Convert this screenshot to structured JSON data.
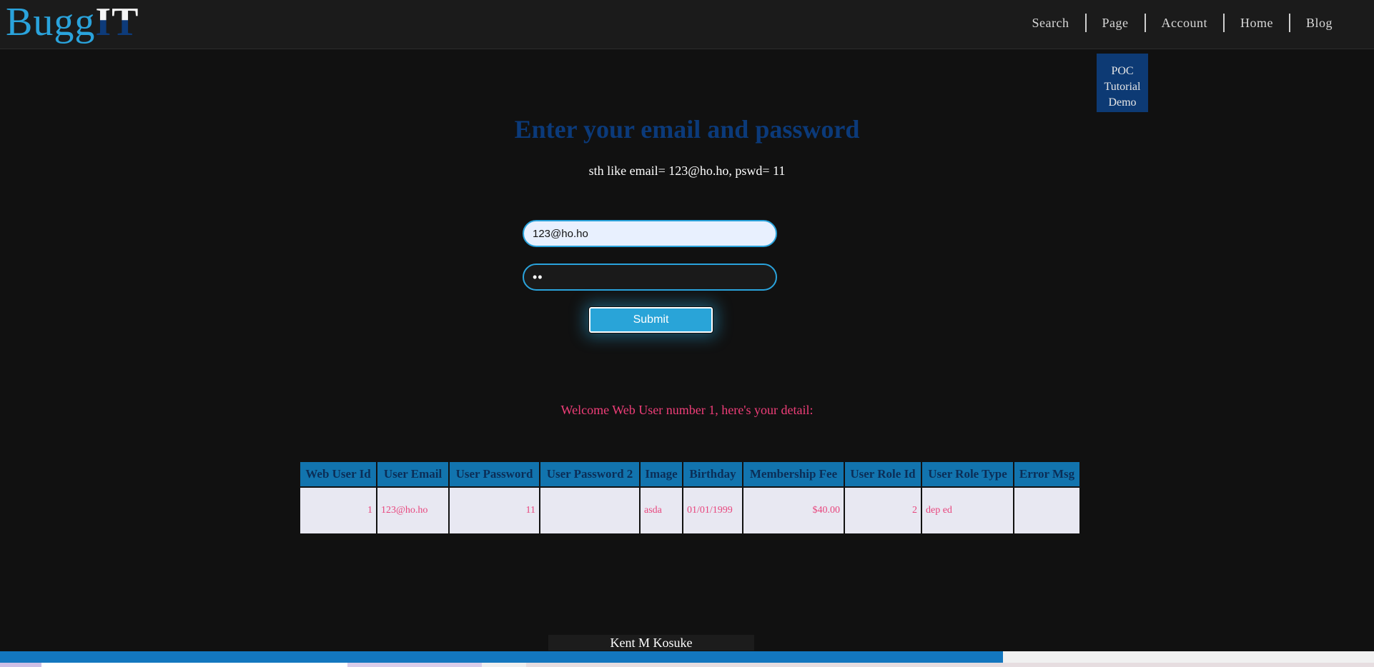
{
  "brand": {
    "logo_part1": "Bugg",
    "logo_part2": "IT"
  },
  "nav": {
    "items": [
      {
        "label": "Search"
      },
      {
        "label": "Page"
      },
      {
        "label": "Account"
      },
      {
        "label": "Home"
      },
      {
        "label": "Blog"
      }
    ]
  },
  "poc_button": {
    "line1": "POC",
    "line2": "Tutorial",
    "line3": "Demo"
  },
  "login": {
    "title": "Enter your email and password",
    "hint": "sth like email= 123@ho.ho, pswd= 11",
    "email_value": "123@ho.ho",
    "password_value": "11",
    "submit_label": "Submit"
  },
  "welcome": "Welcome Web User number 1, here's your detail:",
  "table": {
    "headers": [
      "Web User Id",
      "User Email",
      "User Password",
      "User Password 2",
      "Image",
      "Birthday",
      "Membership Fee",
      "User Role Id",
      "User Role Type",
      "Error Msg"
    ],
    "rows": [
      [
        "1",
        "123@ho.ho",
        "11",
        "",
        "asda",
        "01/01/1999",
        "$40.00",
        "2",
        "dep ed",
        ""
      ]
    ]
  },
  "footer": {
    "author": "Kent M Kosuke",
    "progress": 0.73
  },
  "colors": {
    "accent": "#2aa3dc",
    "title": "#0b3a7a",
    "welcome": "#f03e79",
    "table_header": "#1274ae",
    "poc_bg": "#0d3a74"
  }
}
